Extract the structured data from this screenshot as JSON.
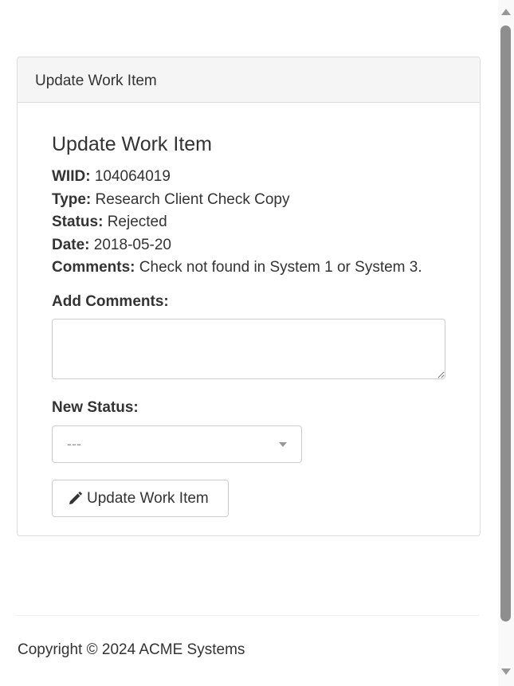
{
  "panel": {
    "heading": "Update Work Item"
  },
  "form": {
    "title": "Update Work Item",
    "details": [
      {
        "label": "WIID:",
        "value": "104064019"
      },
      {
        "label": "Type:",
        "value": "Research Client Check Copy"
      },
      {
        "label": "Status:",
        "value": "Rejected"
      },
      {
        "label": "Date:",
        "value": "2018-05-20"
      },
      {
        "label": "Comments:",
        "value": "Check not found in System 1 or System 3."
      }
    ],
    "add_comments_label": "Add Comments:",
    "add_comments_value": "",
    "new_status_label": "New Status:",
    "new_status_selected": "---",
    "submit_label": "Update Work Item",
    "submit_icon": "pencil-icon"
  },
  "footer": {
    "copyright": "Copyright © 2024 ACME Systems"
  },
  "colors": {
    "panel_heading_bg": "#f5f5f5",
    "border": "#dddddd",
    "text": "#333333",
    "placeholder": "#999999",
    "scroll_thumb": "#8e8e8e"
  }
}
